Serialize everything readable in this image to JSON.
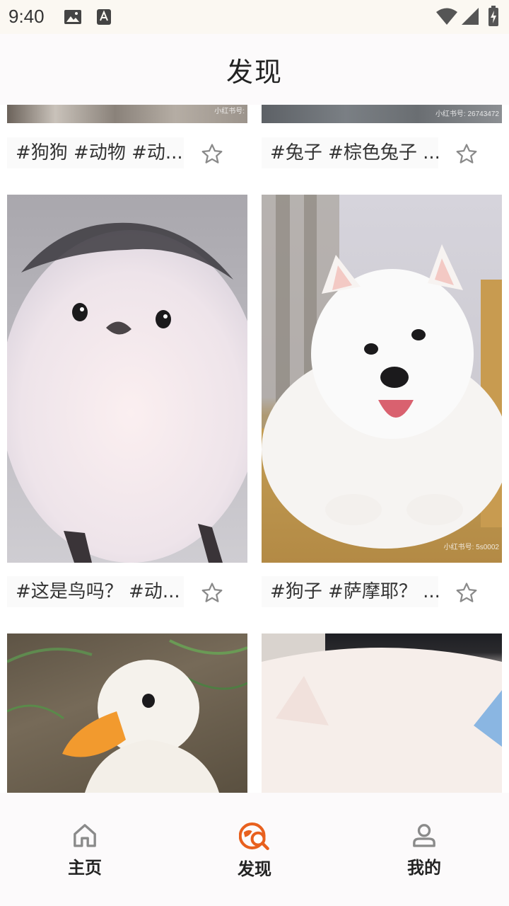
{
  "status_bar": {
    "time": "9:40",
    "icons": [
      "gallery-icon",
      "font-badge-icon",
      "wifi-icon",
      "signal-icon",
      "battery-charging-icon"
    ]
  },
  "header": {
    "title": "发现"
  },
  "feed": {
    "cards": [
      {
        "caption": "#狗狗 #动物 #动...",
        "image": "dog-photo-top-cropped",
        "watermark": "小红书号:"
      },
      {
        "caption": "#兔子 #棕色兔子 ...",
        "image": "brown-rabbit-photo-top-cropped",
        "watermark": "小红书号: 26743472"
      },
      {
        "caption": "#这是鸟吗？ #动...",
        "image": "white-fluffy-bird-photo"
      },
      {
        "caption": "#狗子 #萨摩耶？ ...",
        "image": "samoyed-puppy-photo",
        "watermark": "小红书号: 5s0002"
      },
      {
        "caption": "",
        "image": "white-duck-photo"
      },
      {
        "caption": "",
        "image": "white-cat-photo"
      }
    ],
    "star_icon": "star-outline-icon"
  },
  "bottom_nav": {
    "items": [
      {
        "label": "主页",
        "icon": "home-icon",
        "active": false
      },
      {
        "label": "发现",
        "icon": "discover-icon",
        "active": true
      },
      {
        "label": "我的",
        "icon": "profile-icon",
        "active": false
      }
    ],
    "active_color": "#e8601e",
    "inactive_color": "#8a8a8a"
  }
}
